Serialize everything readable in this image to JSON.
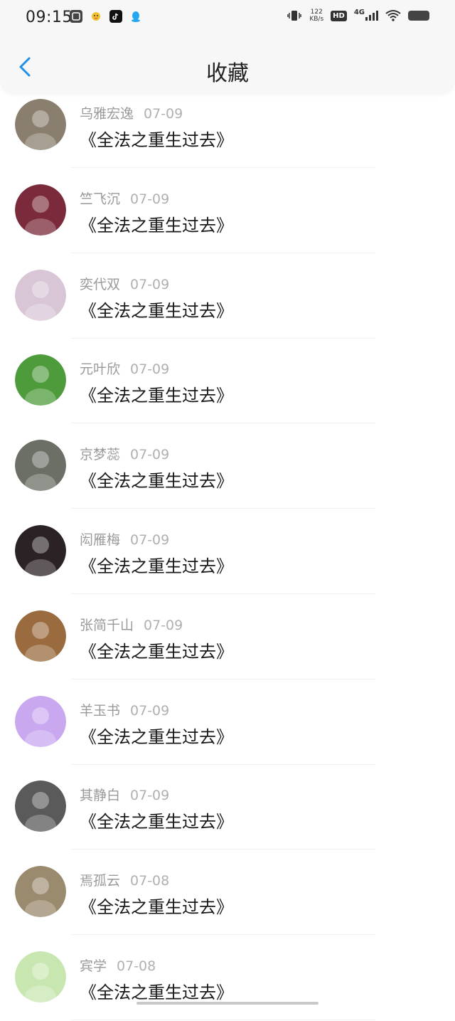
{
  "status_bar": {
    "time": "09:15",
    "net_speed_value": "122",
    "net_speed_unit": "KB/s",
    "hd_label": "HD",
    "signal_label": "4G"
  },
  "nav": {
    "title": "收藏",
    "back_icon": "chevron-left-icon"
  },
  "favorites": [
    {
      "name": "乌雅宏逸",
      "date": "07-09",
      "book": "《全法之重生过去》",
      "avatar_color": "#8a7f6e"
    },
    {
      "name": "竺飞沉",
      "date": "07-09",
      "book": "《全法之重生过去》",
      "avatar_color": "#7a2a3a"
    },
    {
      "name": "奕代双",
      "date": "07-09",
      "book": "《全法之重生过去》",
      "avatar_color": "#d8c6d6"
    },
    {
      "name": "元叶欣",
      "date": "07-09",
      "book": "《全法之重生过去》",
      "avatar_color": "#4e9b3c"
    },
    {
      "name": "京梦蕊",
      "date": "07-09",
      "book": "《全法之重生过去》",
      "avatar_color": "#6b6f66"
    },
    {
      "name": "闳雁梅",
      "date": "07-09",
      "book": "《全法之重生过去》",
      "avatar_color": "#2a2224"
    },
    {
      "name": "张简千山",
      "date": "07-09",
      "book": "《全法之重生过去》",
      "avatar_color": "#9a6b3e"
    },
    {
      "name": "羊玉书",
      "date": "07-09",
      "book": "《全法之重生过去》",
      "avatar_color": "#c9a8f0"
    },
    {
      "name": "其静白",
      "date": "07-09",
      "book": "《全法之重生过去》",
      "avatar_color": "#5a5a5a"
    },
    {
      "name": "焉孤云",
      "date": "07-08",
      "book": "《全法之重生过去》",
      "avatar_color": "#9a8a6e"
    },
    {
      "name": "宾学",
      "date": "07-08",
      "book": "《全法之重生过去》",
      "avatar_color": "#c8e6b0"
    }
  ]
}
